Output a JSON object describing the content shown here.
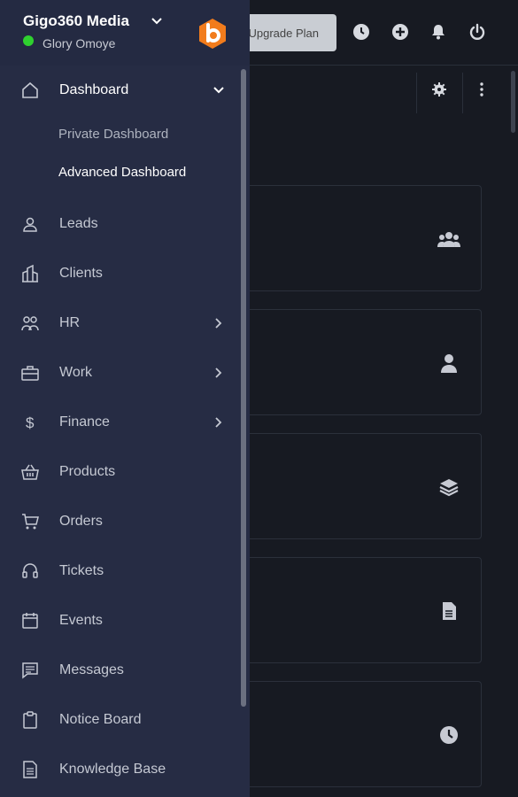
{
  "topbar": {
    "upgrade_label": "Upgrade Plan",
    "icons": [
      "clock-icon",
      "plus-circle-icon",
      "bell-icon",
      "power-icon"
    ]
  },
  "subbar": {
    "icons": [
      "gear-icon",
      "more-vertical-icon"
    ]
  },
  "cards": [
    {
      "icon": "users-icon"
    },
    {
      "icon": "user-icon"
    },
    {
      "icon": "layers-icon"
    },
    {
      "icon": "document-icon"
    },
    {
      "icon": "clock-icon"
    }
  ],
  "sidebar": {
    "company": "Gigo360 Media",
    "user": "Glory Omoye",
    "status_color": "#2fd12f",
    "logo_color": "#f27c1c",
    "dashboard": {
      "label": "Dashboard",
      "sub": [
        "Private Dashboard",
        "Advanced Dashboard"
      ]
    },
    "items": [
      {
        "label": "Leads",
        "icon": "user-icon"
      },
      {
        "label": "Clients",
        "icon": "building-icon"
      },
      {
        "label": "HR",
        "icon": "users-icon",
        "expandable": true
      },
      {
        "label": "Work",
        "icon": "briefcase-icon",
        "expandable": true
      },
      {
        "label": "Finance",
        "icon": "dollar-icon",
        "expandable": true
      },
      {
        "label": "Products",
        "icon": "basket-icon"
      },
      {
        "label": "Orders",
        "icon": "cart-icon"
      },
      {
        "label": "Tickets",
        "icon": "headset-icon"
      },
      {
        "label": "Events",
        "icon": "calendar-icon"
      },
      {
        "label": "Messages",
        "icon": "message-icon"
      },
      {
        "label": "Notice Board",
        "icon": "clipboard-icon"
      },
      {
        "label": "Knowledge Base",
        "icon": "book-icon"
      }
    ]
  }
}
